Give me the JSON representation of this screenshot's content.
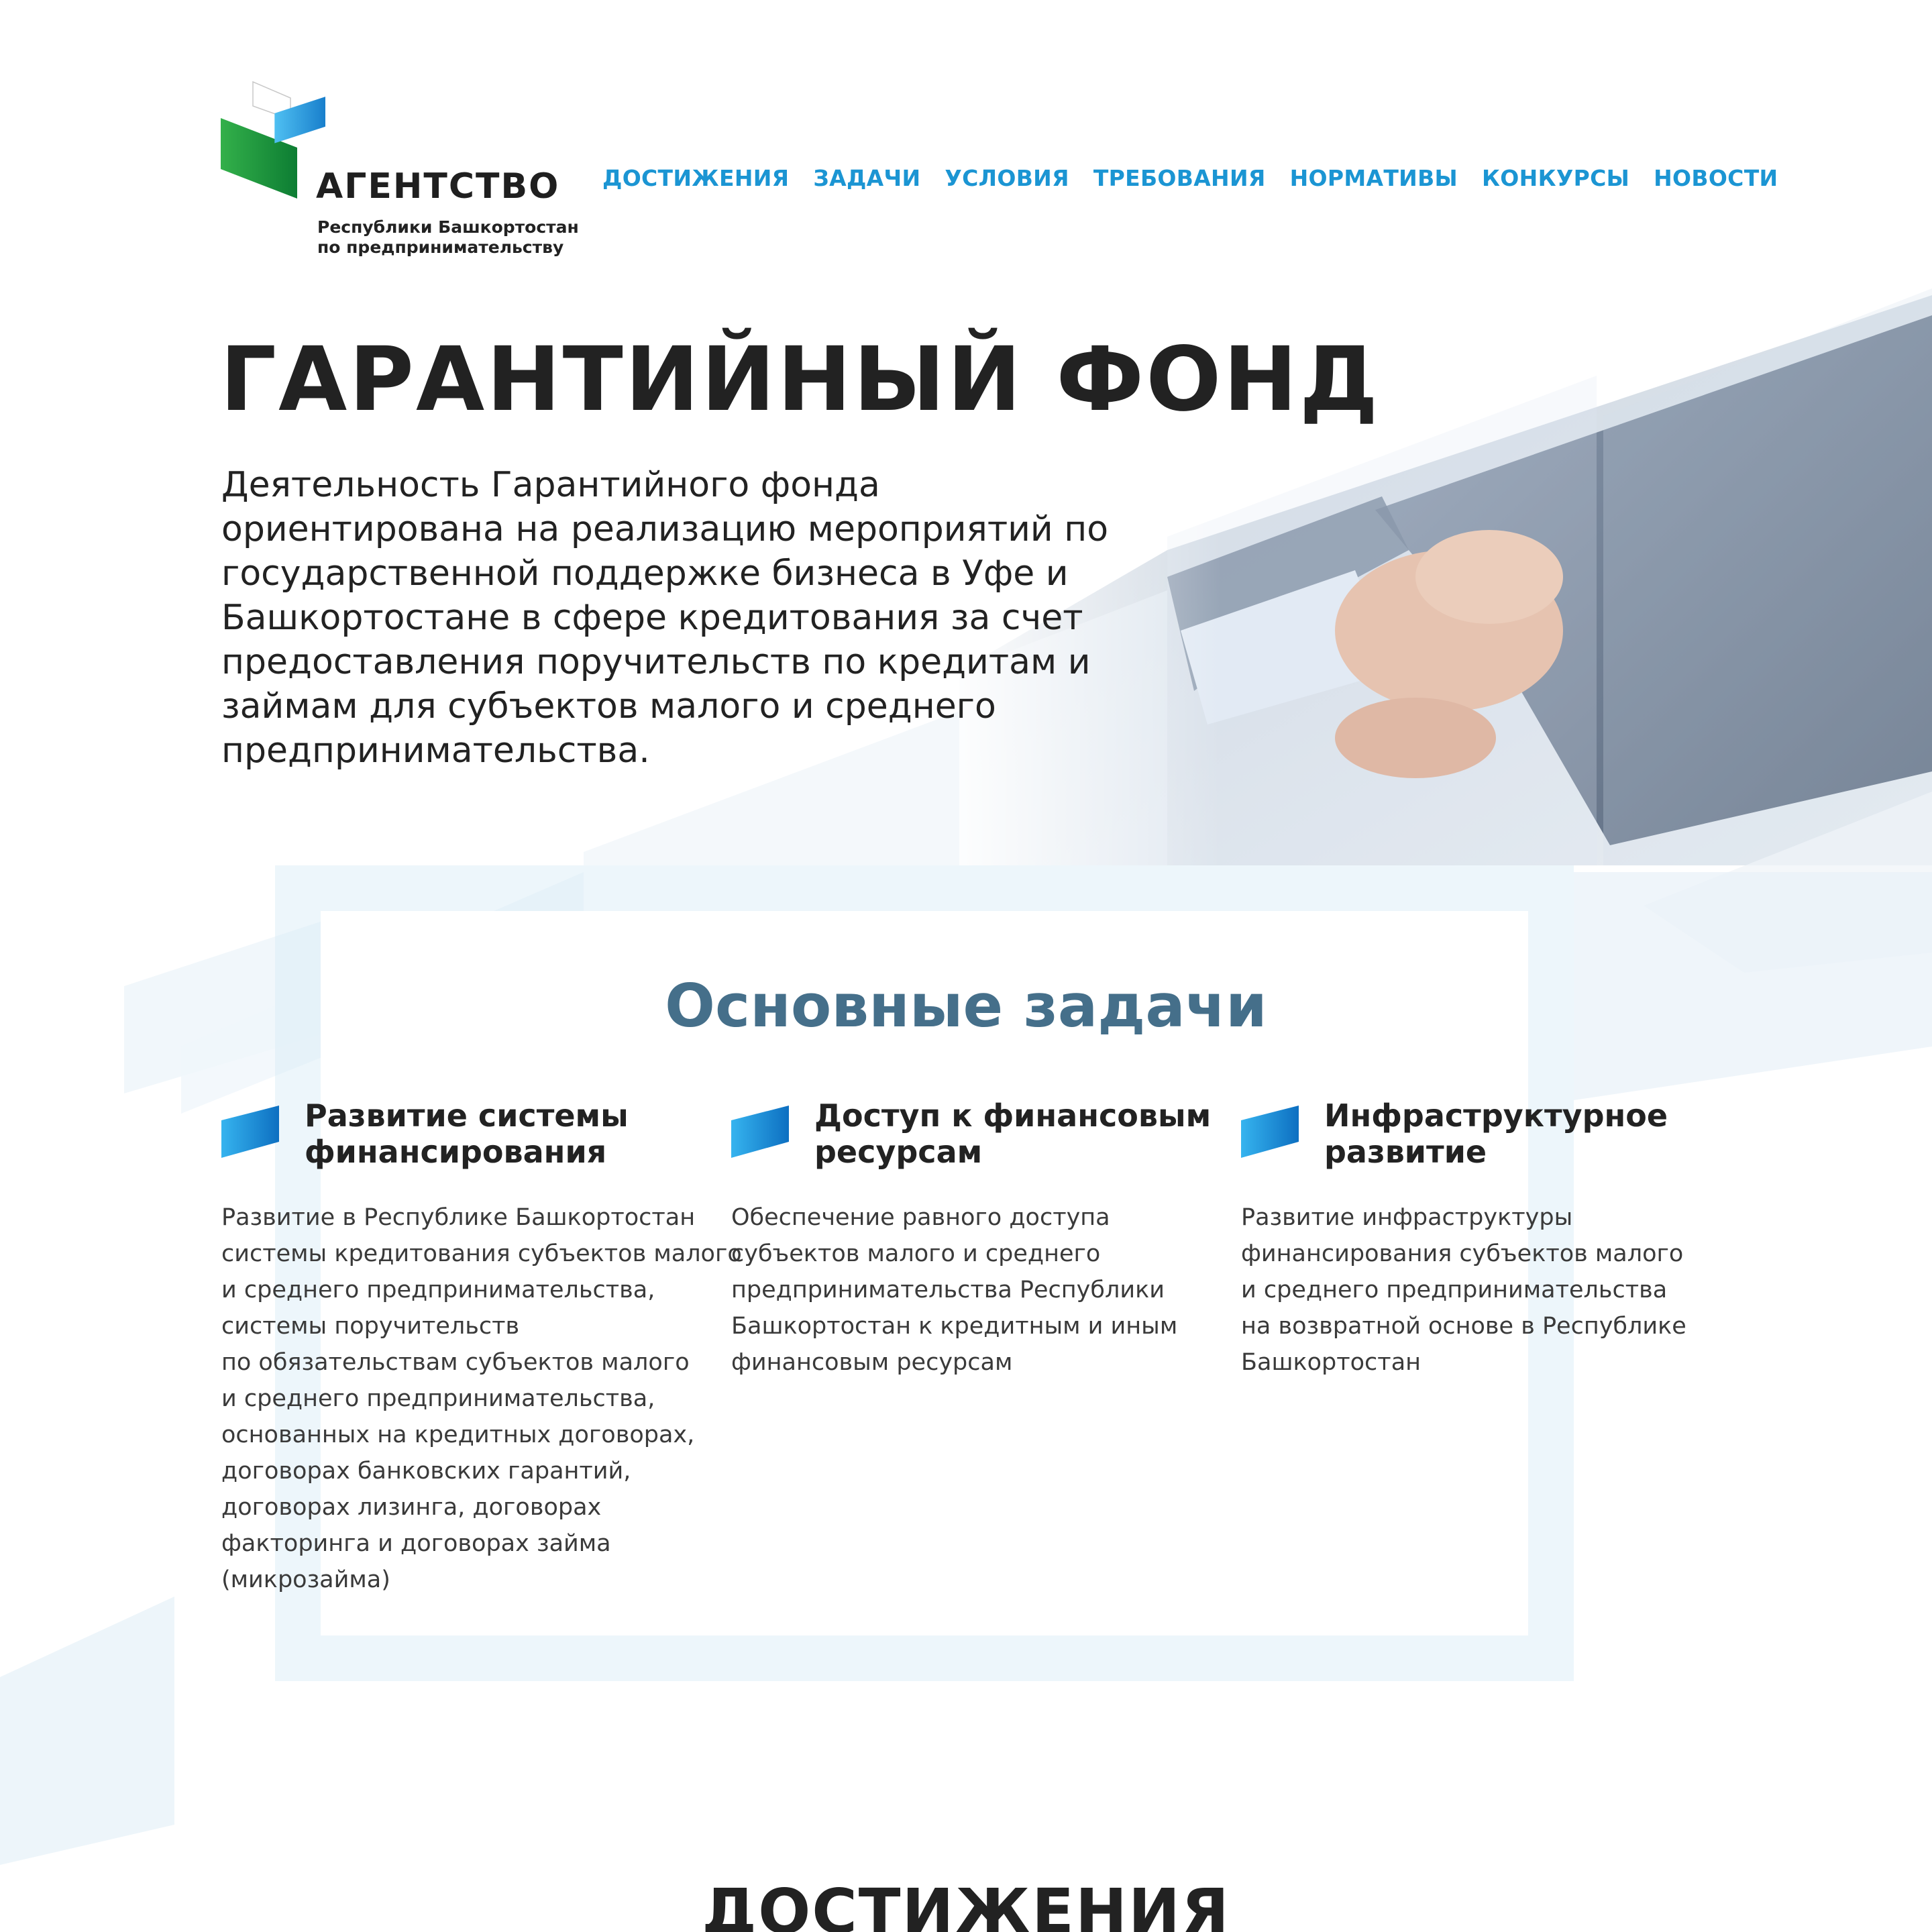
{
  "header": {
    "logo": {
      "title": "АГЕНТСТВО",
      "subtitle_line1": "Республики Башкортостан",
      "subtitle_line2": "по предпринимательству"
    },
    "nav": [
      {
        "label": "ДОСТИЖЕНИЯ"
      },
      {
        "label": "ЗАДАЧИ"
      },
      {
        "label": "УСЛОВИЯ"
      },
      {
        "label": "ТРЕБОВАНИЯ"
      },
      {
        "label": "НОРМАТИВЫ"
      },
      {
        "label": "КОНКУРСЫ"
      },
      {
        "label": "НОВОСТИ"
      }
    ]
  },
  "hero": {
    "title": "ГАРАНТИЙНЫЙ ФОНД",
    "text_lines": [
      "Деятельность Гарантийного фонда",
      "ориентирована на реализацию мероприятий по",
      "государственной поддержке бизнеса в Уфе и",
      "Башкортостане в сфере кредитования за счет",
      "предоставления поручительств по кредитам и",
      "займам для субъектов малого и среднего",
      "предпринимательства."
    ],
    "image_icon": "handshake-photo"
  },
  "tasks": {
    "title": "Основные задачи",
    "items": [
      {
        "title_lines": [
          "Развитие системы",
          "финансирования"
        ],
        "desc_lines": [
          "Развитие в Республике Башкортостан",
          "системы кредитования субъектов малого",
          "и среднего предпринимательства,",
          "системы поручительств",
          "по обязательствам субъектов малого",
          "и среднего предпринимательства,",
          "основанных на кредитных договорах,",
          "договорах банковских гарантий,",
          "договорах лизинга, договорах",
          "факторинга и договорах займа",
          "(микрозайма)"
        ]
      },
      {
        "title_lines": [
          "Доступ к финансовым",
          "ресурсам"
        ],
        "desc_lines": [
          "Обеспечение равного доступа",
          "субъектов малого и среднего",
          "предпринимательства Республики",
          "Башкортостан к кредитным и иным",
          "финансовым ресурсам"
        ]
      },
      {
        "title_lines": [
          "Инфраструктурное",
          "развитие"
        ],
        "desc_lines": [
          "Развитие инфраструктуры",
          "финансирования субъектов малого",
          "и среднего предпринимательства",
          "на возвратной основе в Республике",
          "Башкортостан"
        ]
      }
    ]
  },
  "achievements": {
    "title": "ДОСТИЖЕНИЯ"
  },
  "colors": {
    "nav": "#1b95d3",
    "section_title": "#456f8a",
    "text": "#222222",
    "logo_green": "#1e9a3c",
    "logo_blue": "#1a8fd6"
  }
}
